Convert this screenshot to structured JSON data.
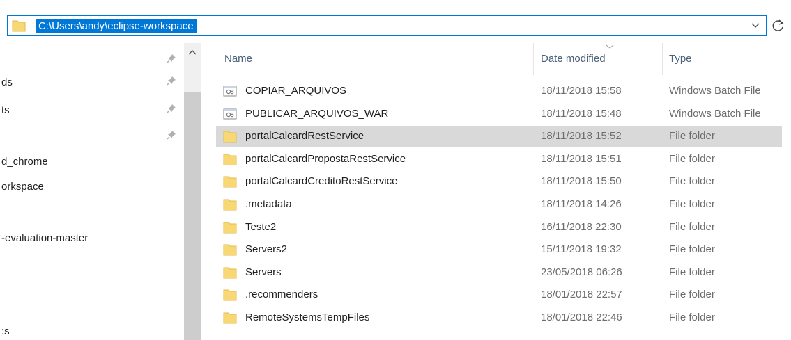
{
  "address": {
    "path": "C:\\Users\\andy\\eclipse-workspace"
  },
  "nav": {
    "items": [
      {
        "label": "ds",
        "pinned": true
      },
      {
        "label": "ts",
        "pinned": true
      },
      {
        "label": "",
        "pinned": true
      },
      {
        "label": "d_chrome",
        "pinned": false
      },
      {
        "label": "orkspace",
        "pinned": false
      },
      {
        "label": "-evaluation-master",
        "pinned": false
      },
      {
        "label": ":s",
        "pinned": false
      }
    ]
  },
  "columns": {
    "name": "Name",
    "date": "Date modified",
    "type": "Type"
  },
  "files": [
    {
      "name": "COPIAR_ARQUIVOS",
      "date": "18/11/2018 15:58",
      "type": "Windows Batch File",
      "icon": "batch-file-icon",
      "selected": false
    },
    {
      "name": "PUBLICAR_ARQUIVOS_WAR",
      "date": "18/11/2018 15:48",
      "type": "Windows Batch File",
      "icon": "batch-file-icon",
      "selected": false
    },
    {
      "name": "portalCalcardRestService",
      "date": "18/11/2018 15:52",
      "type": "File folder",
      "icon": "folder-icon",
      "selected": true
    },
    {
      "name": "portalCalcardPropostaRestService",
      "date": "18/11/2018 15:51",
      "type": "File folder",
      "icon": "folder-icon",
      "selected": false
    },
    {
      "name": "portalCalcardCreditoRestService",
      "date": "18/11/2018 15:50",
      "type": "File folder",
      "icon": "folder-icon",
      "selected": false
    },
    {
      "name": ".metadata",
      "date": "18/11/2018 14:26",
      "type": "File folder",
      "icon": "folder-icon",
      "selected": false
    },
    {
      "name": "Teste2",
      "date": "16/11/2018 22:30",
      "type": "File folder",
      "icon": "folder-icon",
      "selected": false
    },
    {
      "name": "Servers2",
      "date": "15/11/2018 19:32",
      "type": "File folder",
      "icon": "folder-icon",
      "selected": false
    },
    {
      "name": "Servers",
      "date": "23/05/2018 06:26",
      "type": "File folder",
      "icon": "folder-icon",
      "selected": false
    },
    {
      "name": ".recommenders",
      "date": "18/01/2018 22:57",
      "type": "File folder",
      "icon": "folder-icon",
      "selected": false
    },
    {
      "name": "RemoteSystemsTempFiles",
      "date": "18/01/2018 22:46",
      "type": "File folder",
      "icon": "folder-icon",
      "selected": false
    }
  ],
  "colors": {
    "accent": "#0078d7",
    "selection": "#d9d9d9",
    "folder": "#f8d775",
    "folder_dark": "#e7b84a",
    "header_text": "#4c607a",
    "muted_text": "#6d6d6d"
  }
}
